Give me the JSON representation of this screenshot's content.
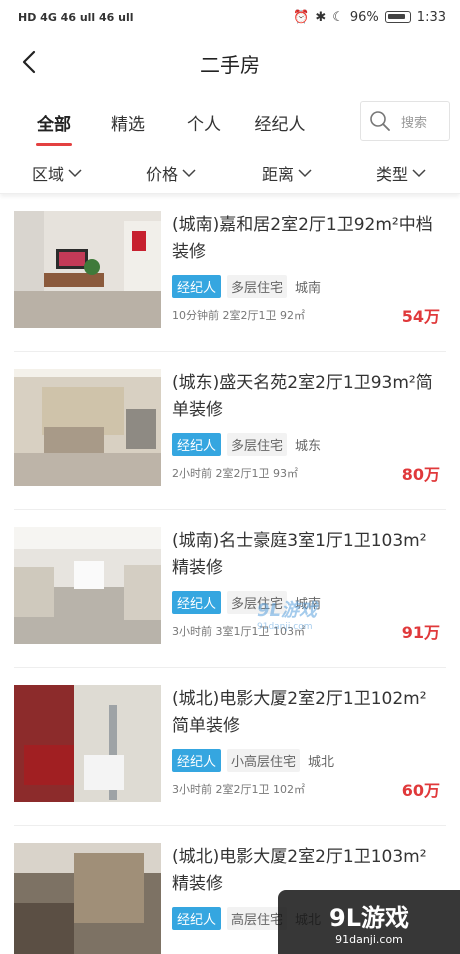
{
  "status_bar": {
    "left": "HD 4G 46 ull 46 ull",
    "battery": "96%",
    "time": "1:33"
  },
  "header": {
    "title": "二手房"
  },
  "tabs": [
    {
      "label": "全部",
      "active": true
    },
    {
      "label": "精选",
      "active": false
    },
    {
      "label": "个人",
      "active": false
    },
    {
      "label": "经纪人",
      "active": false
    }
  ],
  "search": {
    "placeholder": "搜索"
  },
  "filters": [
    {
      "label": "区域"
    },
    {
      "label": "价格"
    },
    {
      "label": "距离"
    },
    {
      "label": "类型"
    }
  ],
  "listings": [
    {
      "title": "(城南)嘉和居2室2厅1卫92m²中档装修",
      "tag_agent": "经纪人",
      "tag_type": "多层住宅",
      "tag_area": "城南",
      "meta": "10分钟前 2室2厅1卫 92㎡",
      "price": "54万"
    },
    {
      "title": "(城东)盛天名苑2室2厅1卫93m²简单装修",
      "tag_agent": "经纪人",
      "tag_type": "多层住宅",
      "tag_area": "城东",
      "meta": "2小时前 2室2厅1卫 93㎡",
      "price": "80万"
    },
    {
      "title": "(城南)名士豪庭3室1厅1卫103m²精装修",
      "tag_agent": "经纪人",
      "tag_type": "多层住宅",
      "tag_area": "城南",
      "meta": "3小时前 3室1厅1卫 103㎡",
      "price": "91万"
    },
    {
      "title": "(城北)电影大厦2室2厅1卫102m²简单装修",
      "tag_agent": "经纪人",
      "tag_type": "小高层住宅",
      "tag_area": "城北",
      "meta": "3小时前 2室2厅1卫 102㎡",
      "price": "60万"
    },
    {
      "title": "(城北)电影大厦2室2厅1卫103m²精装修",
      "tag_agent": "经纪人",
      "tag_type": "高层住宅",
      "tag_area": "城北",
      "meta": "",
      "price": ""
    }
  ],
  "watermark": {
    "center": "9L游戏",
    "center_sub": "91danji.com",
    "corner": "9L游戏",
    "corner_sub": "91danji.com"
  },
  "colors": {
    "accent": "#e34040",
    "price": "#e0393b",
    "agent_tag": "#35a6e0"
  }
}
